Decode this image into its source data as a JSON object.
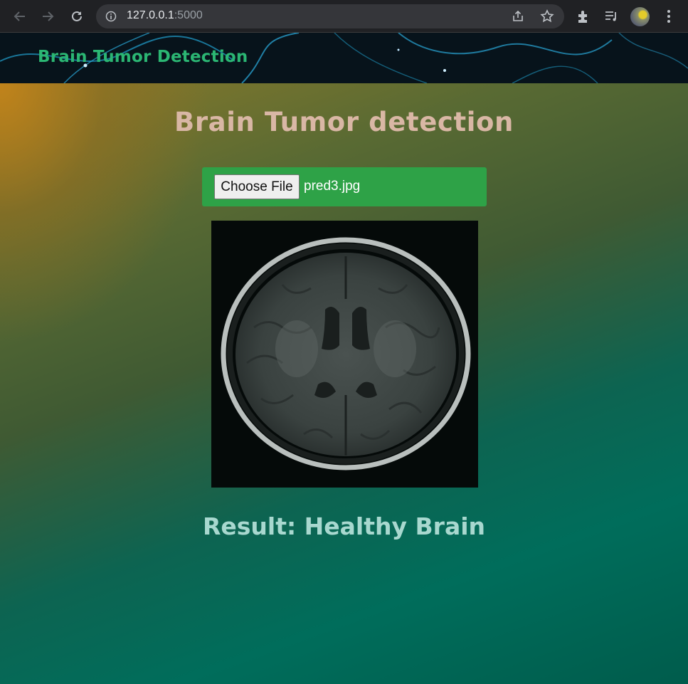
{
  "browser": {
    "url_host": "127.0.0.1",
    "url_port": ":5000",
    "icons": [
      "back-arrow-icon",
      "forward-arrow-icon",
      "reload-icon",
      "info-icon",
      "share-icon",
      "star-icon",
      "extensions-icon",
      "media-control-icon",
      "profile-avatar",
      "menu-dots-icon"
    ]
  },
  "header": {
    "logo_text": "Brain Tumor Detection"
  },
  "main": {
    "title": "Brain Tumor detection",
    "upload": {
      "button_label": "Choose File",
      "file_name": "pred3.jpg"
    },
    "result_text": "Result: Healthy Brain"
  },
  "colors": {
    "logo": "#2bb673",
    "title": "#d9b7a5",
    "upload_bg": "#2ea247",
    "result": "#a8d8cf"
  }
}
